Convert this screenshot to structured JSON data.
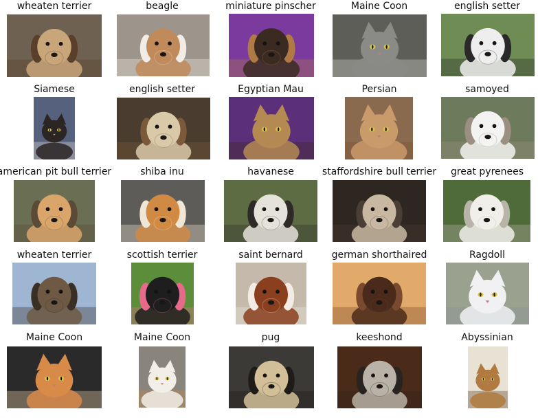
{
  "grid": {
    "rows": [
      [
        {
          "label": "wheaten terrier",
          "subject": "dog",
          "colors": {
            "bg": "#6f6152",
            "fur": "#c9a57a",
            "accent": "#5a3f2b"
          }
        },
        {
          "label": "beagle",
          "subject": "dog",
          "colors": {
            "bg": "#9d958b",
            "fur": "#c08a5a",
            "accent": "#f1ece5"
          }
        },
        {
          "label": "miniature pinscher",
          "subject": "dog",
          "colors": {
            "bg": "#7b3a9e",
            "fur": "#3a2a22",
            "accent": "#b07a45"
          }
        },
        {
          "label": "Maine Coon",
          "subject": "cat",
          "colors": {
            "bg": "#5c5e57",
            "fur": "#8a8b86",
            "accent": "#d8d8d4"
          }
        },
        {
          "label": "english setter",
          "subject": "dog",
          "colors": {
            "bg": "#6f8c55",
            "fur": "#eeeeee",
            "accent": "#2a2a2a"
          }
        }
      ],
      [
        {
          "label": "Siamese",
          "subject": "cat",
          "colors": {
            "bg": "#56627d",
            "fur": "#2b2624",
            "accent": "#e8e2da"
          }
        },
        {
          "label": "english setter",
          "subject": "dog",
          "colors": {
            "bg": "#4a3c2e",
            "fur": "#d9c9a8",
            "accent": "#7a5a3a"
          }
        },
        {
          "label": "Egyptian Mau",
          "subject": "cat",
          "colors": {
            "bg": "#5c2f7a",
            "fur": "#b48a52",
            "accent": "#3a2a1a"
          }
        },
        {
          "label": "Persian",
          "subject": "cat",
          "colors": {
            "bg": "#8a6a4e",
            "fur": "#c99a6a",
            "accent": "#7a4f30"
          }
        },
        {
          "label": "samoyed",
          "subject": "dog",
          "colors": {
            "bg": "#6d7a5b",
            "fur": "#f3f3f1",
            "accent": "#9a8f80"
          }
        }
      ],
      [
        {
          "label": "american pit bull terrier",
          "subject": "dog",
          "colors": {
            "bg": "#6a6e53",
            "fur": "#d9a56a",
            "accent": "#5a4a36"
          }
        },
        {
          "label": "shiba inu",
          "subject": "dog",
          "colors": {
            "bg": "#5e5c58",
            "fur": "#d08a44",
            "accent": "#f0e6d6"
          }
        },
        {
          "label": "havanese",
          "subject": "dog",
          "colors": {
            "bg": "#5e6c44",
            "fur": "#e5e2da",
            "accent": "#2d2a28"
          }
        },
        {
          "label": "staffordshire bull terrier",
          "subject": "dog",
          "colors": {
            "bg": "#2e2620",
            "fur": "#c8b8a2",
            "accent": "#4a3f36"
          }
        },
        {
          "label": "great pyrenees",
          "subject": "dog",
          "colors": {
            "bg": "#4f6b3a",
            "fur": "#f0efea",
            "accent": "#b9b4a8"
          }
        }
      ],
      [
        {
          "label": "wheaten terrier",
          "subject": "dog",
          "colors": {
            "bg": "#9fb6d3",
            "fur": "#6e5a44",
            "accent": "#3a2f25"
          }
        },
        {
          "label": "scottish terrier",
          "subject": "dog",
          "colors": {
            "bg": "#5c8d3a",
            "fur": "#1e1e1e",
            "accent": "#e66b8a"
          }
        },
        {
          "label": "saint bernard",
          "subject": "dog",
          "colors": {
            "bg": "#c4b9aa",
            "fur": "#8a3f1e",
            "accent": "#f2ece4"
          }
        },
        {
          "label": "german shorthaired",
          "subject": "dog",
          "colors": {
            "bg": "#e2aa6a",
            "fur": "#4a2a1a",
            "accent": "#7a4a2e"
          }
        },
        {
          "label": "Ragdoll",
          "subject": "cat",
          "colors": {
            "bg": "#9aa28f",
            "fur": "#f1f1f3",
            "accent": "#8a8f9a"
          }
        }
      ],
      [
        {
          "label": "Maine Coon",
          "subject": "cat",
          "colors": {
            "bg": "#2a2a2a",
            "fur": "#d88a48",
            "accent": "#f0d6b0"
          }
        },
        {
          "label": "Maine Coon",
          "subject": "cat",
          "colors": {
            "bg": "#8a857c",
            "fur": "#f2efe8",
            "accent": "#c28a4e"
          }
        },
        {
          "label": "pug",
          "subject": "dog",
          "colors": {
            "bg": "#3c3a36",
            "fur": "#d2bf98",
            "accent": "#1f1b18"
          }
        },
        {
          "label": "keeshond",
          "subject": "dog",
          "colors": {
            "bg": "#4a2a18",
            "fur": "#b9b2a6",
            "accent": "#2a2420"
          }
        },
        {
          "label": "Abyssinian",
          "subject": "cat",
          "colors": {
            "bg": "#e8e2d4",
            "fur": "#b07a40",
            "accent": "#5a3a20"
          }
        }
      ]
    ]
  }
}
